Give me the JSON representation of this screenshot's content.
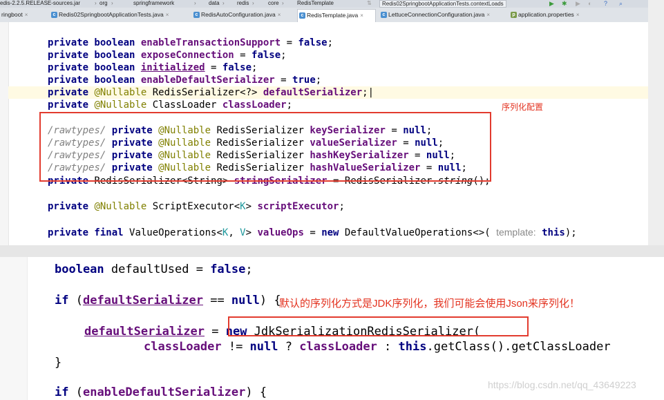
{
  "breadcrumb": {
    "project": "edis-2.2.5.RELEASE-sources.jar",
    "segments": [
      "org",
      "springframework",
      "data",
      "redis",
      "core",
      "RedisTemplate"
    ],
    "run_config": "Redis02SpringbootApplicationTests.contextLoads"
  },
  "tabs": [
    {
      "label": "ringboot",
      "icon": "m",
      "active": false
    },
    {
      "label": "Redis02SpringbootApplicationTests.java",
      "icon": "c",
      "active": false
    },
    {
      "label": "RedisAutoConfiguration.java",
      "icon": "c",
      "active": false
    },
    {
      "label": "RedisTemplate.java",
      "icon": "c",
      "active": true
    },
    {
      "label": "LettuceConnectionConfiguration.java",
      "icon": "c",
      "active": false
    },
    {
      "label": "application.properties",
      "icon": "p",
      "active": false
    }
  ],
  "editor_top": {
    "lines": [
      "private boolean enableTransactionSupport = false;",
      "private boolean exposeConnection = false;",
      "private boolean initialized = false;",
      "private boolean enableDefaultSerializer = true;",
      "private @Nullable RedisSerializer<?> defaultSerializer;",
      "private @Nullable ClassLoader classLoader;",
      "",
      "/rawtypes/ private @Nullable RedisSerializer keySerializer = null;",
      "/rawtypes/ private @Nullable RedisSerializer valueSerializer = null;",
      "/rawtypes/ private @Nullable RedisSerializer hashKeySerializer = null;",
      "/rawtypes/ private @Nullable RedisSerializer hashValueSerializer = null;",
      "private RedisSerializer<String> stringSerializer = RedisSerializer.string();",
      "",
      "private @Nullable ScriptExecutor<K> scriptExecutor;",
      "",
      "private final ValueOperations<K, V> valueOps = new DefaultValueOperations<>( template: this);"
    ],
    "annotation": "序列化配置"
  },
  "editor_bottom": {
    "lines": [
      "boolean defaultUsed = false;",
      "",
      "if (defaultSerializer == null) {",
      "",
      "defaultSerializer = new JdkSerializationRedisSerializer(",
      "classLoader != null ? classLoader : this.getClass().getClassLoader",
      "}",
      "",
      "if (enableDefaultSerializer) {"
    ],
    "annotation": "默认的序列化方式是JDK序列化，我们可能会使用Json来序列化！",
    "watermark": "https://blog.csdn.net/qq_43649223"
  }
}
